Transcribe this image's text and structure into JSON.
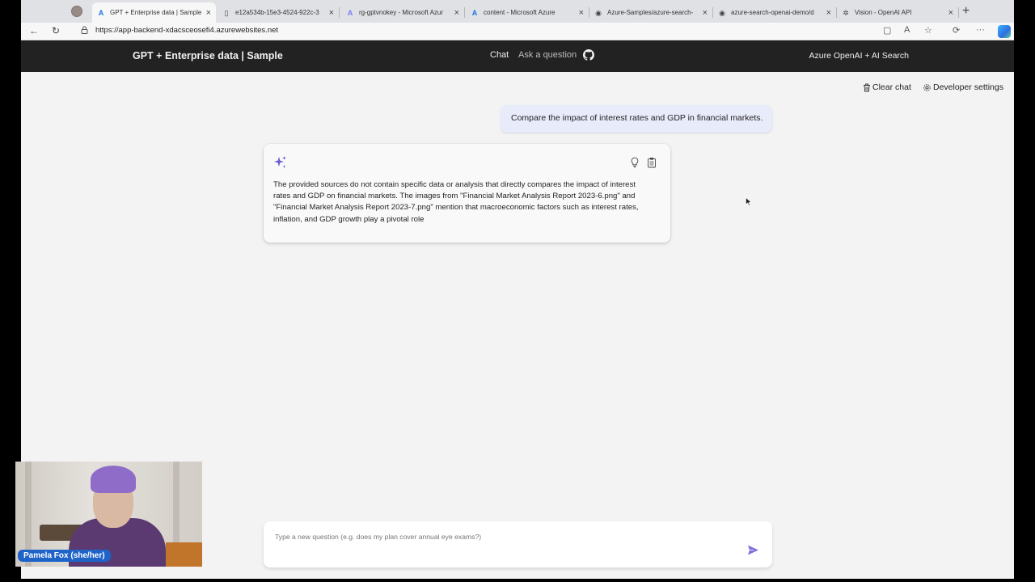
{
  "browser": {
    "tabs": [
      {
        "title": "GPT + Enterprise data | Sample",
        "favicon": "azure-logo-icon",
        "active": true
      },
      {
        "title": "e12a534b-15e3-4524-922c-3",
        "favicon": "document-icon",
        "active": false
      },
      {
        "title": "rg-gptvnokey - Microsoft Azur",
        "favicon": "azure-logo-icon",
        "active": false
      },
      {
        "title": "content - Microsoft Azure",
        "favicon": "azure-logo-icon",
        "active": false
      },
      {
        "title": "Azure-Samples/azure-search-",
        "favicon": "github-icon",
        "active": false
      },
      {
        "title": "azure-search-openai-demo/d",
        "favicon": "github-icon",
        "active": false
      },
      {
        "title": "Vision - OpenAI API",
        "favicon": "openai-icon",
        "active": false
      }
    ],
    "url": "https://app-backend-xdacsceosefi4.azurewebsites.net"
  },
  "header": {
    "brand": "GPT + Enterprise data | Sample",
    "nav_chat": "Chat",
    "nav_ask": "Ask a question",
    "right_title": "Azure OpenAI + AI Search"
  },
  "commands": {
    "clear_chat": "Clear chat",
    "developer_settings": "Developer settings"
  },
  "conversation": {
    "user_question": "Compare the impact of interest rates and GDP in financial markets.",
    "answer": "The provided sources do not contain specific data or analysis that directly compares the impact of interest rates and GDP on financial markets. The images from \"Financial Market Analysis Report 2023-6.png\" and \"Financial Market Analysis Report 2023-7.png\" mention that macroeconomic factors such as interest rates, inflation, and GDP growth play a pivotal role"
  },
  "question_input": {
    "placeholder": "Type a new question (e.g. does my plan cover annual eye exams?)"
  },
  "webcam": {
    "name_label": "Pamela Fox (she/her)"
  },
  "colors": {
    "header_bg": "#222222",
    "user_bubble": "#e8ebfa",
    "accent": "#7f6fd8"
  }
}
